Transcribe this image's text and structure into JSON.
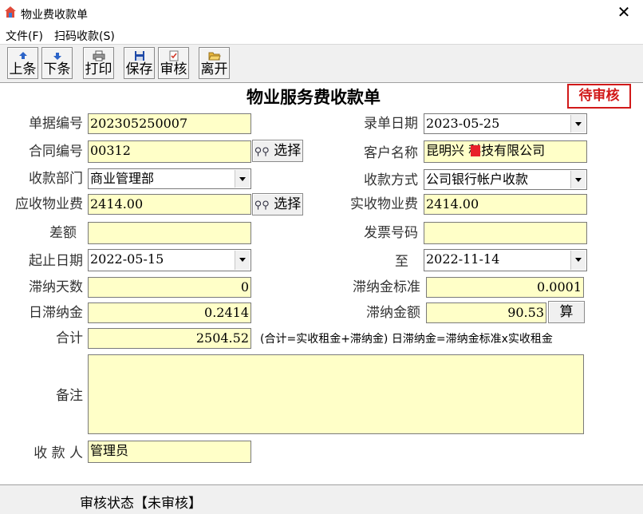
{
  "window": {
    "title": "物业费收款单",
    "close_glyph": "✕"
  },
  "menu": {
    "items": [
      "文件(F)",
      "扫码收款(S)"
    ]
  },
  "toolbar": {
    "buttons": [
      {
        "label": "上条",
        "icon": "arrow-up-icon"
      },
      {
        "label": "下条",
        "icon": "arrow-down-icon"
      },
      {
        "label": "打印",
        "icon": "printer-icon"
      },
      {
        "label": "保存",
        "icon": "floppy-disk-icon"
      },
      {
        "label": "审核",
        "icon": "clipboard-check-icon"
      },
      {
        "label": "离开",
        "icon": "folder-open-icon"
      }
    ]
  },
  "form": {
    "title": "物业服务费收款单",
    "status_stamp": "待审核",
    "labels": {
      "doc_no": "单据编号",
      "entry_date": "录单日期",
      "contract_no": "合同编号",
      "customer": "客户名称",
      "dept": "收款部门",
      "pay_method": "收款方式",
      "receivable": "应收物业费",
      "received": "实收物业费",
      "difference": "差额",
      "invoice_no": "发票号码",
      "start_date": "起止日期",
      "to": "至",
      "late_days": "滞纳天数",
      "late_rate": "滞纳金标准",
      "daily_late": "日滞纳金",
      "late_amount": "滞纳金额",
      "total": "合计",
      "remark": "备注",
      "payee": "收 款 人"
    },
    "values": {
      "doc_no": "202305250007",
      "entry_date": "2023-05-25",
      "contract_no": "00312",
      "customer": "昆明兴  科技有限公司",
      "dept": "商业管理部",
      "pay_method": "公司银行帐户收款",
      "receivable": "2414.00",
      "received": "2414.00",
      "difference": "",
      "invoice_no": "",
      "start_date": "2022-05-15",
      "end_date": "2022-11-14",
      "late_days": "0",
      "late_rate": "0.0001",
      "daily_late": "0.2414",
      "late_amount": "90.53",
      "total": "2504.52",
      "remark": "",
      "payee": "管理员"
    },
    "select_button_label": "选择",
    "calc_button_label": "算",
    "formula_note": "(合计=实收租金+滞纳金) 日滞纳金=滞纳金标准x实收租金"
  },
  "statusbar": {
    "text": "审核状态【未审核】"
  },
  "colors": {
    "field_bg": "#ffffc8",
    "stamp_red": "#d11919",
    "toolbar_bg": "#f0f0f0"
  }
}
